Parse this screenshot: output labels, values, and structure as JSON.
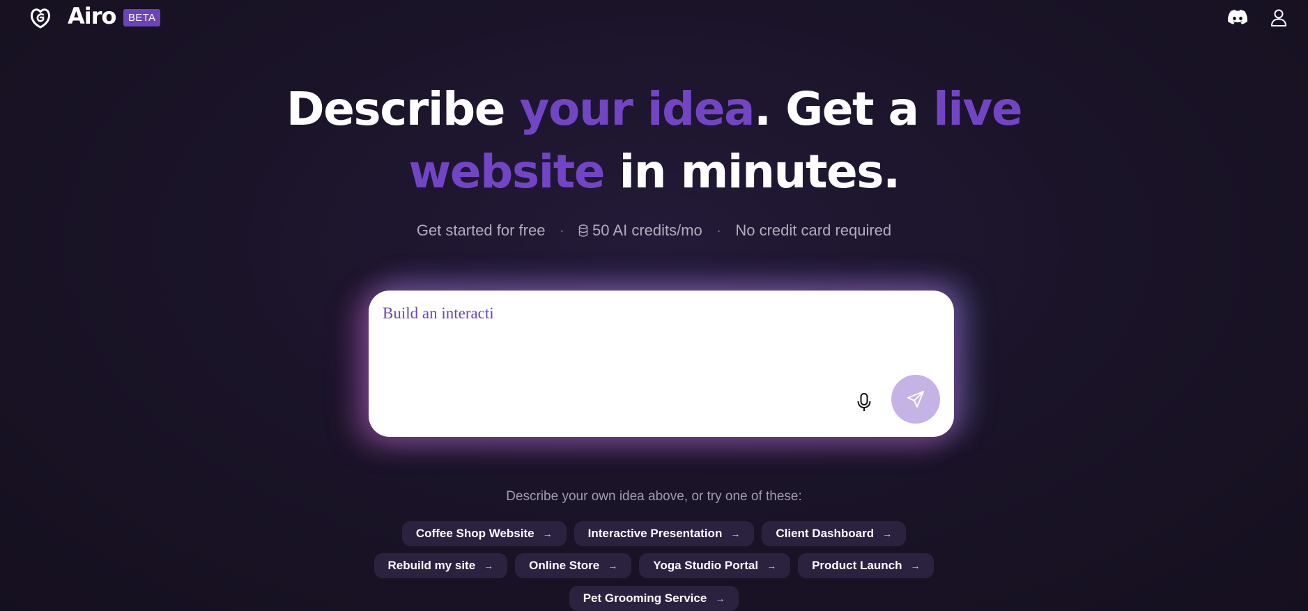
{
  "header": {
    "brand": "Airo",
    "badge": "BETA",
    "icons": [
      "godaddy-logo-icon",
      "discord-icon",
      "user-icon"
    ]
  },
  "hero": {
    "headline": {
      "part1": "Describe ",
      "accent1": "your idea",
      "part2": ". Get a ",
      "accent2": "live",
      "accent3": "website",
      "part3": " in minutes."
    },
    "sub": {
      "item1": "Get started for free",
      "item2": "50 AI credits/mo",
      "item3": "No credit card required",
      "separator": "·"
    }
  },
  "prompt": {
    "value": "Build an interacti"
  },
  "suggestions": {
    "label": "Describe your own idea above, or try one of these:",
    "chips": [
      "Coffee Shop Website",
      "Interactive Presentation",
      "Client Dashboard",
      "Rebuild my site",
      "Online Store",
      "Yoga Studio Portal",
      "Product Launch",
      "Pet Grooming Service"
    ],
    "arrow": "→"
  },
  "colors": {
    "accent": "#7245c4",
    "badge": "#6a44b8",
    "send_button": "#c6b3e6",
    "chip_bg": "#2b2240"
  }
}
